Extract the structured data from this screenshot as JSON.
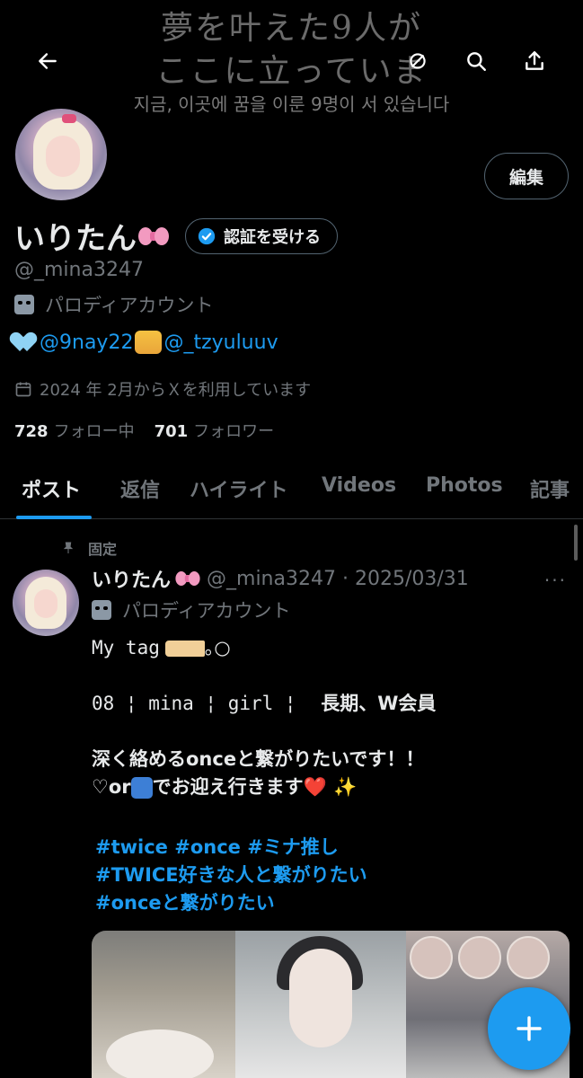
{
  "banner": {
    "line1": "夢を叶えた9人が",
    "line2": "ここに立っていま",
    "line3": "지금, 이곳에 꿈을 이룬 9명이 서 있습니다"
  },
  "profile": {
    "name": "いりたん",
    "handle": "@_mina3247",
    "parody_label": "パロディアカウント",
    "edit_label": "編集",
    "verify_label": "認証を受ける",
    "bio_link1": "@9nay22",
    "bio_link2": "@_tzyuluuv",
    "joined": "2024 年 2月からＸを利用しています",
    "following_count": "728",
    "following_label": "フォロー中",
    "followers_count": "701",
    "followers_label": "フォロワー"
  },
  "tabs": [
    "ポスト",
    "返信",
    "ハイライト",
    "Videos",
    "Photos",
    "記事"
  ],
  "post": {
    "pinned_label": "固定",
    "name": "いりたん",
    "meta": "@_mina3247 · 2025/03/31",
    "more": "···",
    "parody_label": "パロディアカウント",
    "line1": "My tag",
    "line1_suffix": "｡○",
    "line2": "08 ¦ mina ¦ girl ¦",
    "line2b": "長期、W会員",
    "line3": "深く絡めるonceと繋がりたいです！！",
    "line4a": "♡or",
    "line4b": "でお迎え行きます",
    "heart": "❤️",
    "sparkle": "✨",
    "hashtags": [
      "#twice #once #ミナ推し",
      "#TWICE好きな人と繋がりたい",
      "#onceと繋がりたい"
    ]
  },
  "icons": {
    "back": "arrow-left-icon",
    "search": "search-icon",
    "share": "share-icon",
    "compose": "plus-icon"
  }
}
